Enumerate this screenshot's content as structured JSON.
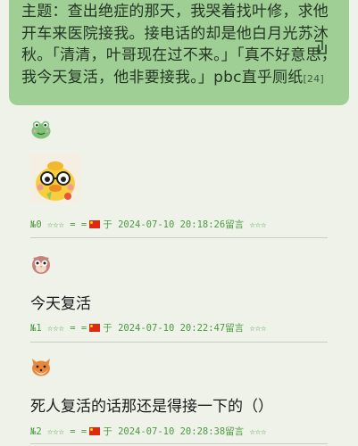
{
  "topic": {
    "text": "主题：查出绝症的那天，我哭着找叶修，求他开车来医院接我。接电话的却是他白月光苏沐秋。「清清，叶哥现在过不来。」「真不好意思，我今天复活，他非要接我。」pbc直乎厕纸",
    "reply_count": "[24]",
    "return_icon": "return-icon"
  },
  "posts": [
    {
      "avatar": "frog-avatar",
      "content_type": "sticker",
      "sticker": "duck-sticker",
      "meta": {
        "number": "№0",
        "stars_left": "☆☆☆",
        "eq": "= =",
        "flag": "china-flag",
        "at": "于",
        "datetime": "2024-07-10 20:18:26留言",
        "stars_right": "☆☆☆"
      }
    },
    {
      "avatar": "owl-avatar",
      "content_type": "text",
      "text": "今天复活",
      "meta": {
        "number": "№1",
        "stars_left": "☆☆☆",
        "eq": "= =",
        "flag": "china-flag",
        "at": "于",
        "datetime": "2024-07-10 20:22:47留言",
        "stars_right": "☆☆☆"
      }
    },
    {
      "avatar": "fox-avatar",
      "content_type": "text",
      "text": "死人复活的话那还是得接一下的（）",
      "meta": {
        "number": "№2",
        "stars_left": "☆☆☆",
        "eq": "= =",
        "flag": "china-flag",
        "at": "于",
        "datetime": "2024-07-10 20:28:38留言",
        "stars_right": "☆☆☆"
      }
    }
  ],
  "colors": {
    "background": "#eef2e9",
    "topic_bg": "#9fcf95",
    "meta_green": "#4c9a3f",
    "flag_red": "#de2910"
  }
}
